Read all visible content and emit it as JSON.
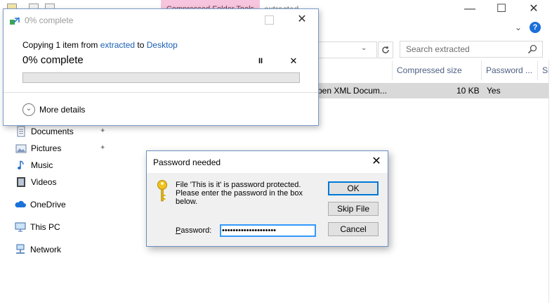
{
  "explorer": {
    "ribbon_context_tab": "Compressed Folder Tools",
    "ribbon_tab": "extracted",
    "window_controls": {
      "minimize": "—",
      "maximize": "☐",
      "close": "✕"
    },
    "help_glyph": "?",
    "search_placeholder": "Search extracted",
    "columns": [
      "Compressed size",
      "Password ...",
      "Si"
    ],
    "file_row": {
      "type": "pen XML Docum...",
      "compressed_size": "10 KB",
      "password": "Yes"
    },
    "nav": [
      {
        "label": "Documents",
        "icon": "documents-icon",
        "pinned": true
      },
      {
        "label": "Pictures",
        "icon": "pictures-icon",
        "pinned": true
      },
      {
        "label": "Music",
        "icon": "music-icon",
        "pinned": false
      },
      {
        "label": "Videos",
        "icon": "videos-icon",
        "pinned": false
      },
      {
        "label": "OneDrive",
        "icon": "onedrive-icon",
        "pinned": false
      },
      {
        "label": "This PC",
        "icon": "pc-icon",
        "pinned": false
      },
      {
        "label": "Network",
        "icon": "network-icon",
        "pinned": false
      }
    ]
  },
  "copy_dialog": {
    "title": "0% complete",
    "line_prefix": "Copying 1 item from ",
    "source": "extracted",
    "line_to": " to ",
    "destination": "Desktop",
    "status": "0% complete",
    "progress_percent": 0,
    "more_details": "More details",
    "pause_glyph": "II",
    "cancel_glyph": "✕",
    "close_glyph": "✕",
    "more_glyph": "⌄"
  },
  "password_dialog": {
    "title": "Password needed",
    "close_glyph": "✕",
    "message": "File 'This is it' is password protected. Please enter the password in the box below.",
    "label": "Password:",
    "value": "••••••••••••••••••••",
    "ok": "OK",
    "skip": "Skip File",
    "cancel": "Cancel"
  },
  "colors": {
    "accent": "#0078d7",
    "link": "#1a5fb4",
    "progress": "#06b025",
    "context_tab": "#f7c6de"
  }
}
